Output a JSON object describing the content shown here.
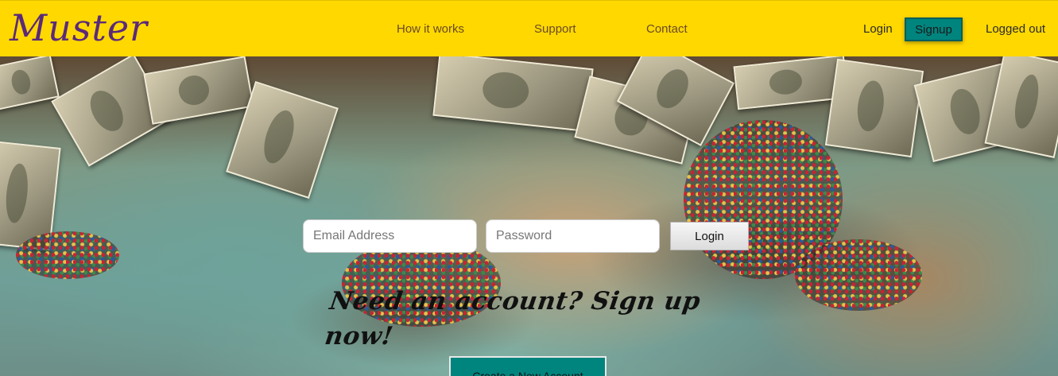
{
  "brand": {
    "logo": "Muster"
  },
  "nav": {
    "links": [
      "How it works",
      "Support",
      "Contact"
    ],
    "login": "Login",
    "signup": "Signup",
    "status": "Logged out"
  },
  "login_form": {
    "email_placeholder": "Email Address",
    "password_placeholder": "Password",
    "submit": "Login"
  },
  "hero": {
    "tagline": "Need an account? Sign up now!",
    "cta": "Create a New Account"
  },
  "colors": {
    "navbar": "#ffd800",
    "logo": "#5a2a7a",
    "accent": "#00847e"
  }
}
